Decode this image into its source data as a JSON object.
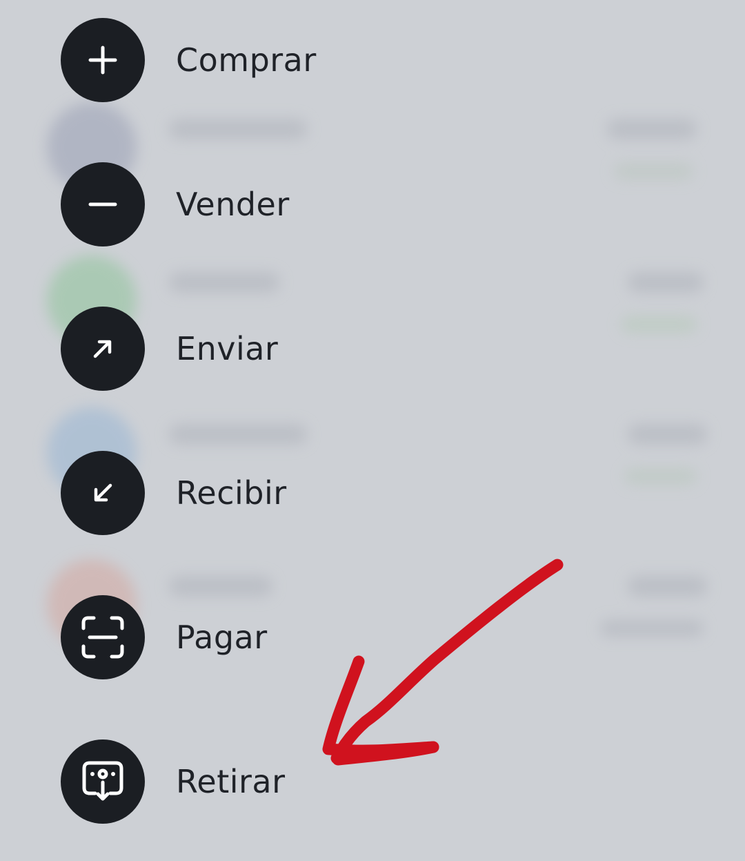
{
  "menu": {
    "items": [
      {
        "label": "Comprar",
        "icon": "plus-icon"
      },
      {
        "label": "Vender",
        "icon": "minus-icon"
      },
      {
        "label": "Enviar",
        "icon": "arrow-up-right-icon"
      },
      {
        "label": "Recibir",
        "icon": "arrow-down-left-icon"
      },
      {
        "label": "Pagar",
        "icon": "scan-icon"
      },
      {
        "label": "Retirar",
        "icon": "withdraw-icon"
      }
    ]
  },
  "colors": {
    "overlay_background": "#cdd0d5",
    "icon_circle": "#1b1e23",
    "label_text": "#1f2228",
    "annotation_arrow": "#d0121e"
  }
}
